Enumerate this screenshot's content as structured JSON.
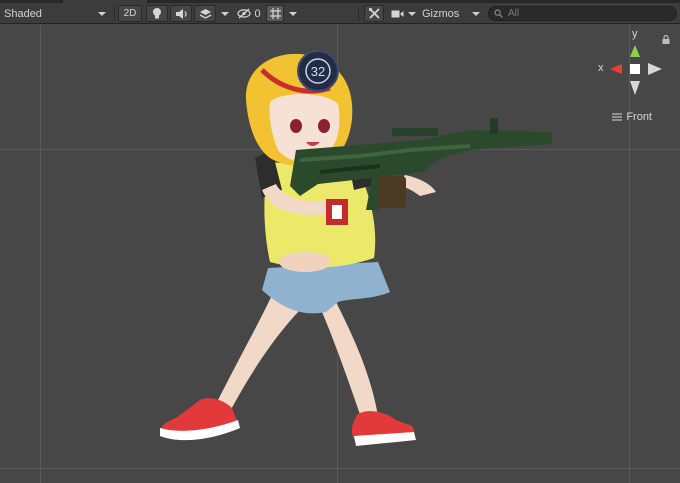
{
  "toolbar": {
    "shading_mode": "Shaded",
    "mode_2d_label": "2D",
    "hidden_count": "0",
    "gizmos_label": "Gizmos",
    "search_placeholder": "All"
  },
  "orientation_gizmo": {
    "y_label": "y",
    "x_label": "x",
    "view_label": "Front"
  },
  "colors": {
    "toolbar_bg": "#3c3c3c",
    "viewport_bg": "#474747",
    "axis_x": "#e8412c",
    "axis_y": "#8bd24a",
    "axis_neutral": "#d7d7d7"
  },
  "icons": {
    "lighting": "lightbulb-icon",
    "audio": "speaker-icon",
    "effects": "layers-icon",
    "visibility": "eye-slash-icon",
    "grid": "grid-icon",
    "tools": "wrench-icon",
    "camera": "camera-icon",
    "search": "search-icon",
    "lock": "lock-icon",
    "menu": "hamburger-icon"
  }
}
